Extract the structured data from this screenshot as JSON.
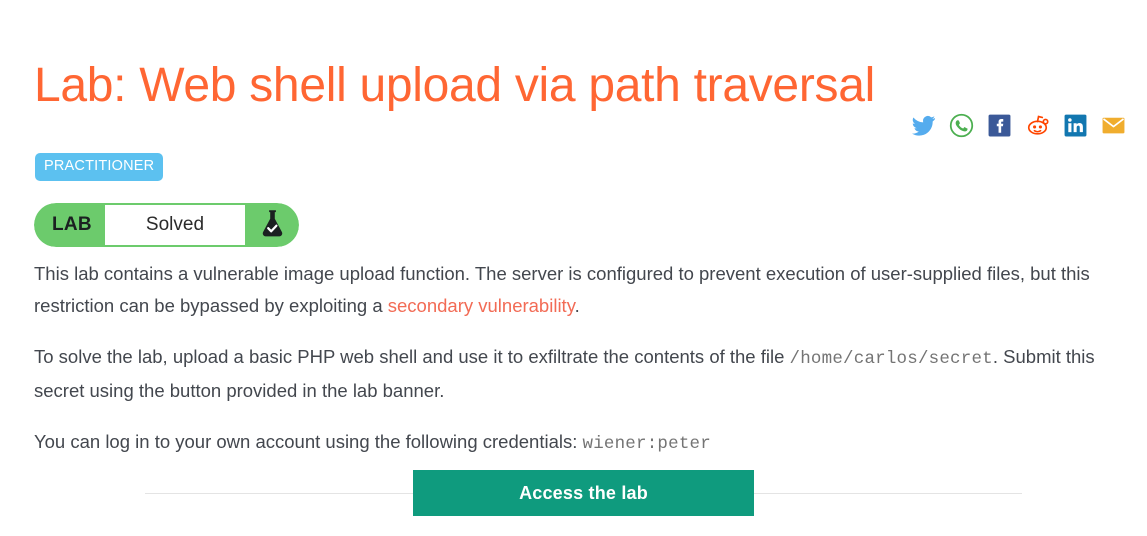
{
  "page": {
    "title": "Lab: Web shell upload via path traversal"
  },
  "share": {
    "icons": [
      {
        "name": "twitter-icon",
        "label": "Twitter",
        "color": "#55acee"
      },
      {
        "name": "whatsapp-icon",
        "label": "WhatsApp",
        "color": "#4caf50"
      },
      {
        "name": "facebook-icon",
        "label": "Facebook",
        "color": "#3b5998"
      },
      {
        "name": "reddit-icon",
        "label": "Reddit",
        "color": "#ff4500"
      },
      {
        "name": "linkedin-icon",
        "label": "LinkedIn",
        "color": "#0e76a8"
      },
      {
        "name": "email-icon",
        "label": "Email",
        "color": "#f0ad2e"
      }
    ]
  },
  "lab": {
    "level": "PRACTITIONER",
    "level_color": "#5cc1f0",
    "status_label": "LAB",
    "status_value": "Solved",
    "status_color": "#6ccb6c",
    "status_icon": "flask-check-icon"
  },
  "body": {
    "p1_part1": "This lab contains a vulnerable image upload function. The server is configured to prevent execution of user-supplied files, but this restriction can be bypassed by exploiting a ",
    "p1_link": "secondary vulnerability",
    "p1_part2": ".",
    "p2_part1": "To solve the lab, upload a basic PHP web shell and use it to exfiltrate the contents of the file ",
    "p2_code": "/home/carlos/secret",
    "p2_part2": ". Submit this secret using the button provided in the lab banner.",
    "p3_part1": "You can log in to your own account using the following credentials: ",
    "p3_code": "wiener:peter"
  },
  "access": {
    "button_label": "Access the lab",
    "button_color": "#0f9b7e"
  }
}
